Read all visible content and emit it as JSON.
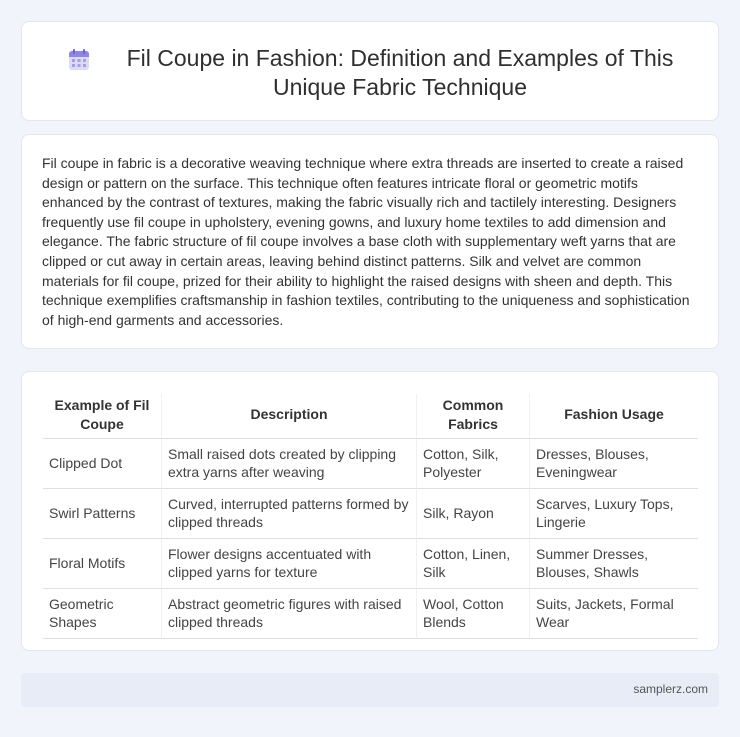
{
  "header": {
    "title": "Fil Coupe in Fashion: Definition and Examples of This Unique Fabric Technique",
    "icon": "calendar-icon"
  },
  "intro": {
    "paragraph": "Fil coupe in fabric is a decorative weaving technique where extra threads are inserted to create a raised design or pattern on the surface. This technique often features intricate floral or geometric motifs enhanced by the contrast of textures, making the fabric visually rich and tactilely interesting. Designers frequently use fil coupe in upholstery, evening gowns, and luxury home textiles to add dimension and elegance. The fabric structure of fil coupe involves a base cloth with supplementary weft yarns that are clipped or cut away in certain areas, leaving behind distinct patterns. Silk and velvet are common materials for fil coupe, prized for their ability to highlight the raised designs with sheen and depth. This technique exemplifies craftsmanship in fashion textiles, contributing to the uniqueness and sophistication of high-end garments and accessories."
  },
  "table": {
    "headers": [
      "Example of Fil Coupe",
      "Description",
      "Common Fabrics",
      "Fashion Usage"
    ],
    "rows": [
      [
        "Clipped Dot",
        "Small raised dots created by clipping extra yarns after weaving",
        "Cotton, Silk, Polyester",
        "Dresses, Blouses, Eveningwear"
      ],
      [
        "Swirl Patterns",
        "Curved, interrupted patterns formed by clipped threads",
        "Silk, Rayon",
        "Scarves, Luxury Tops, Lingerie"
      ],
      [
        "Floral Motifs",
        "Flower designs accentuated with clipped yarns for texture",
        "Cotton, Linen, Silk",
        "Summer Dresses, Blouses, Shawls"
      ],
      [
        "Geometric Shapes",
        "Abstract geometric figures with raised clipped threads",
        "Wool, Cotton Blends",
        "Suits, Jackets, Formal Wear"
      ]
    ]
  },
  "footer": {
    "site": "samplerz.com"
  }
}
